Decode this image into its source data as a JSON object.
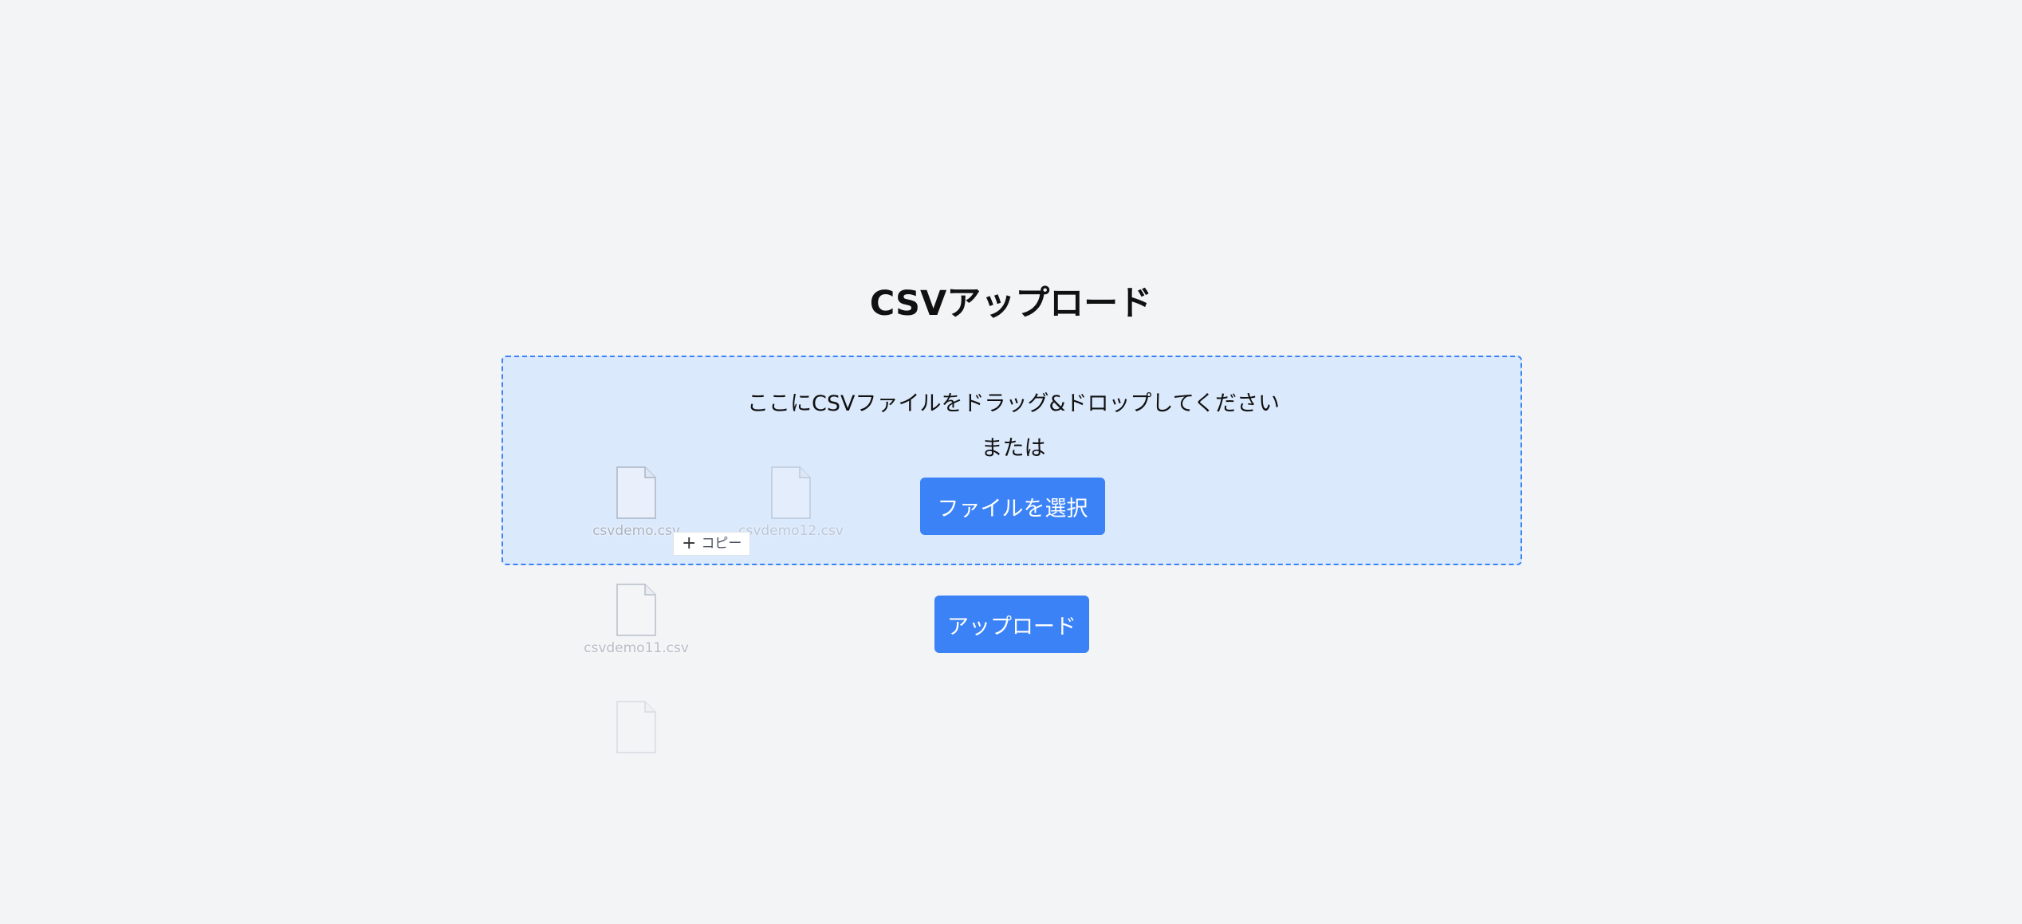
{
  "page": {
    "title": "CSVアップロード"
  },
  "drop_zone": {
    "instruction": "ここにCSVファイルをドラッグ&ドロップしてください",
    "or_text": "または",
    "select_button_label": "ファイルを選択"
  },
  "upload_button_label": "アップロード",
  "drag_ghost": {
    "files": [
      {
        "name": "csvdemo.csv"
      },
      {
        "name": "csvdemo12.csv"
      },
      {
        "name": "csvdemo11.csv"
      },
      {
        "name": ""
      }
    ],
    "copy_badge": {
      "icon": "plus-icon",
      "label": "コピー"
    }
  },
  "colors": {
    "accent": "#3b82f6",
    "drop_zone_bg": "#dbe9fc",
    "page_bg": "#f2f4f6"
  }
}
